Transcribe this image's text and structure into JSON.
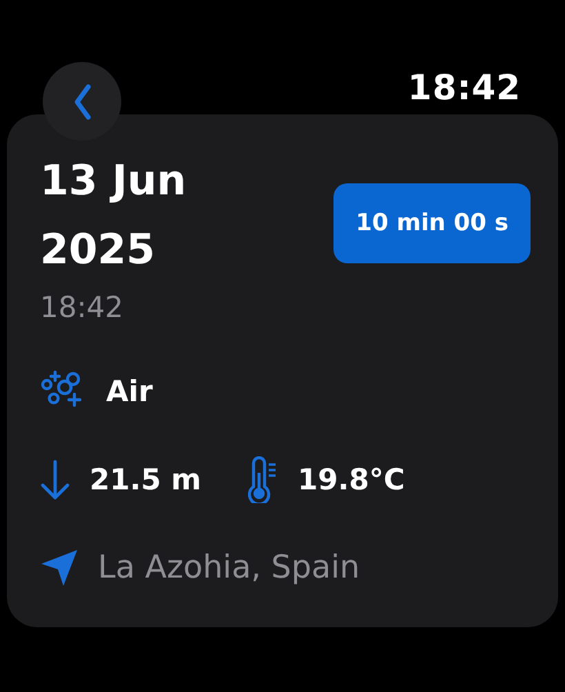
{
  "status_bar": {
    "time": "18:42"
  },
  "dive": {
    "date": "13 Jun 2025",
    "time": "18:42",
    "duration": "10 min 00 s",
    "gas": "Air",
    "depth": "21.5 m",
    "temperature": "19.8°C",
    "location": "La Azohia, Spain"
  }
}
